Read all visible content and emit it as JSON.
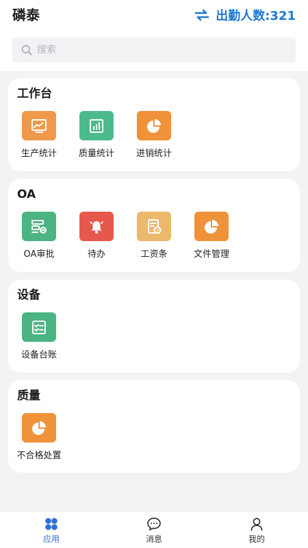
{
  "header": {
    "title": "磷泰",
    "attendance_label": "出勤人数:321"
  },
  "search": {
    "placeholder": "搜索"
  },
  "sections": [
    {
      "title": "工作台",
      "items": [
        {
          "label": "生产统计",
          "icon": "line-chart-icon",
          "color": "#f0994a"
        },
        {
          "label": "质量统计",
          "icon": "bar-chart-icon",
          "color": "#4cbb8c"
        },
        {
          "label": "进销统计",
          "icon": "pie-chart-icon",
          "color": "#f0923a"
        }
      ]
    },
    {
      "title": "OA",
      "items": [
        {
          "label": "OA审批",
          "icon": "approval-icon",
          "color": "#4cb383"
        },
        {
          "label": "待办",
          "icon": "bell-icon",
          "color": "#e6584c"
        },
        {
          "label": "工资条",
          "icon": "payslip-icon",
          "color": "#ecb86b"
        },
        {
          "label": "文件管理",
          "icon": "pie-chart-icon",
          "color": "#f0923a"
        }
      ]
    },
    {
      "title": "设备",
      "items": [
        {
          "label": "设备台账",
          "icon": "checklist-icon",
          "color": "#4cb383"
        }
      ]
    },
    {
      "title": "质量",
      "items": [
        {
          "label": "不合格处置",
          "icon": "pie-chart-icon",
          "color": "#f0923a"
        }
      ]
    }
  ],
  "tabbar": [
    {
      "label": "应用",
      "icon": "apps-icon",
      "active": true
    },
    {
      "label": "消息",
      "icon": "chat-icon",
      "active": false
    },
    {
      "label": "我的",
      "icon": "user-icon",
      "active": false
    }
  ],
  "colors": {
    "accent": "#1e78d2",
    "tab_active": "#2f6fd8"
  }
}
